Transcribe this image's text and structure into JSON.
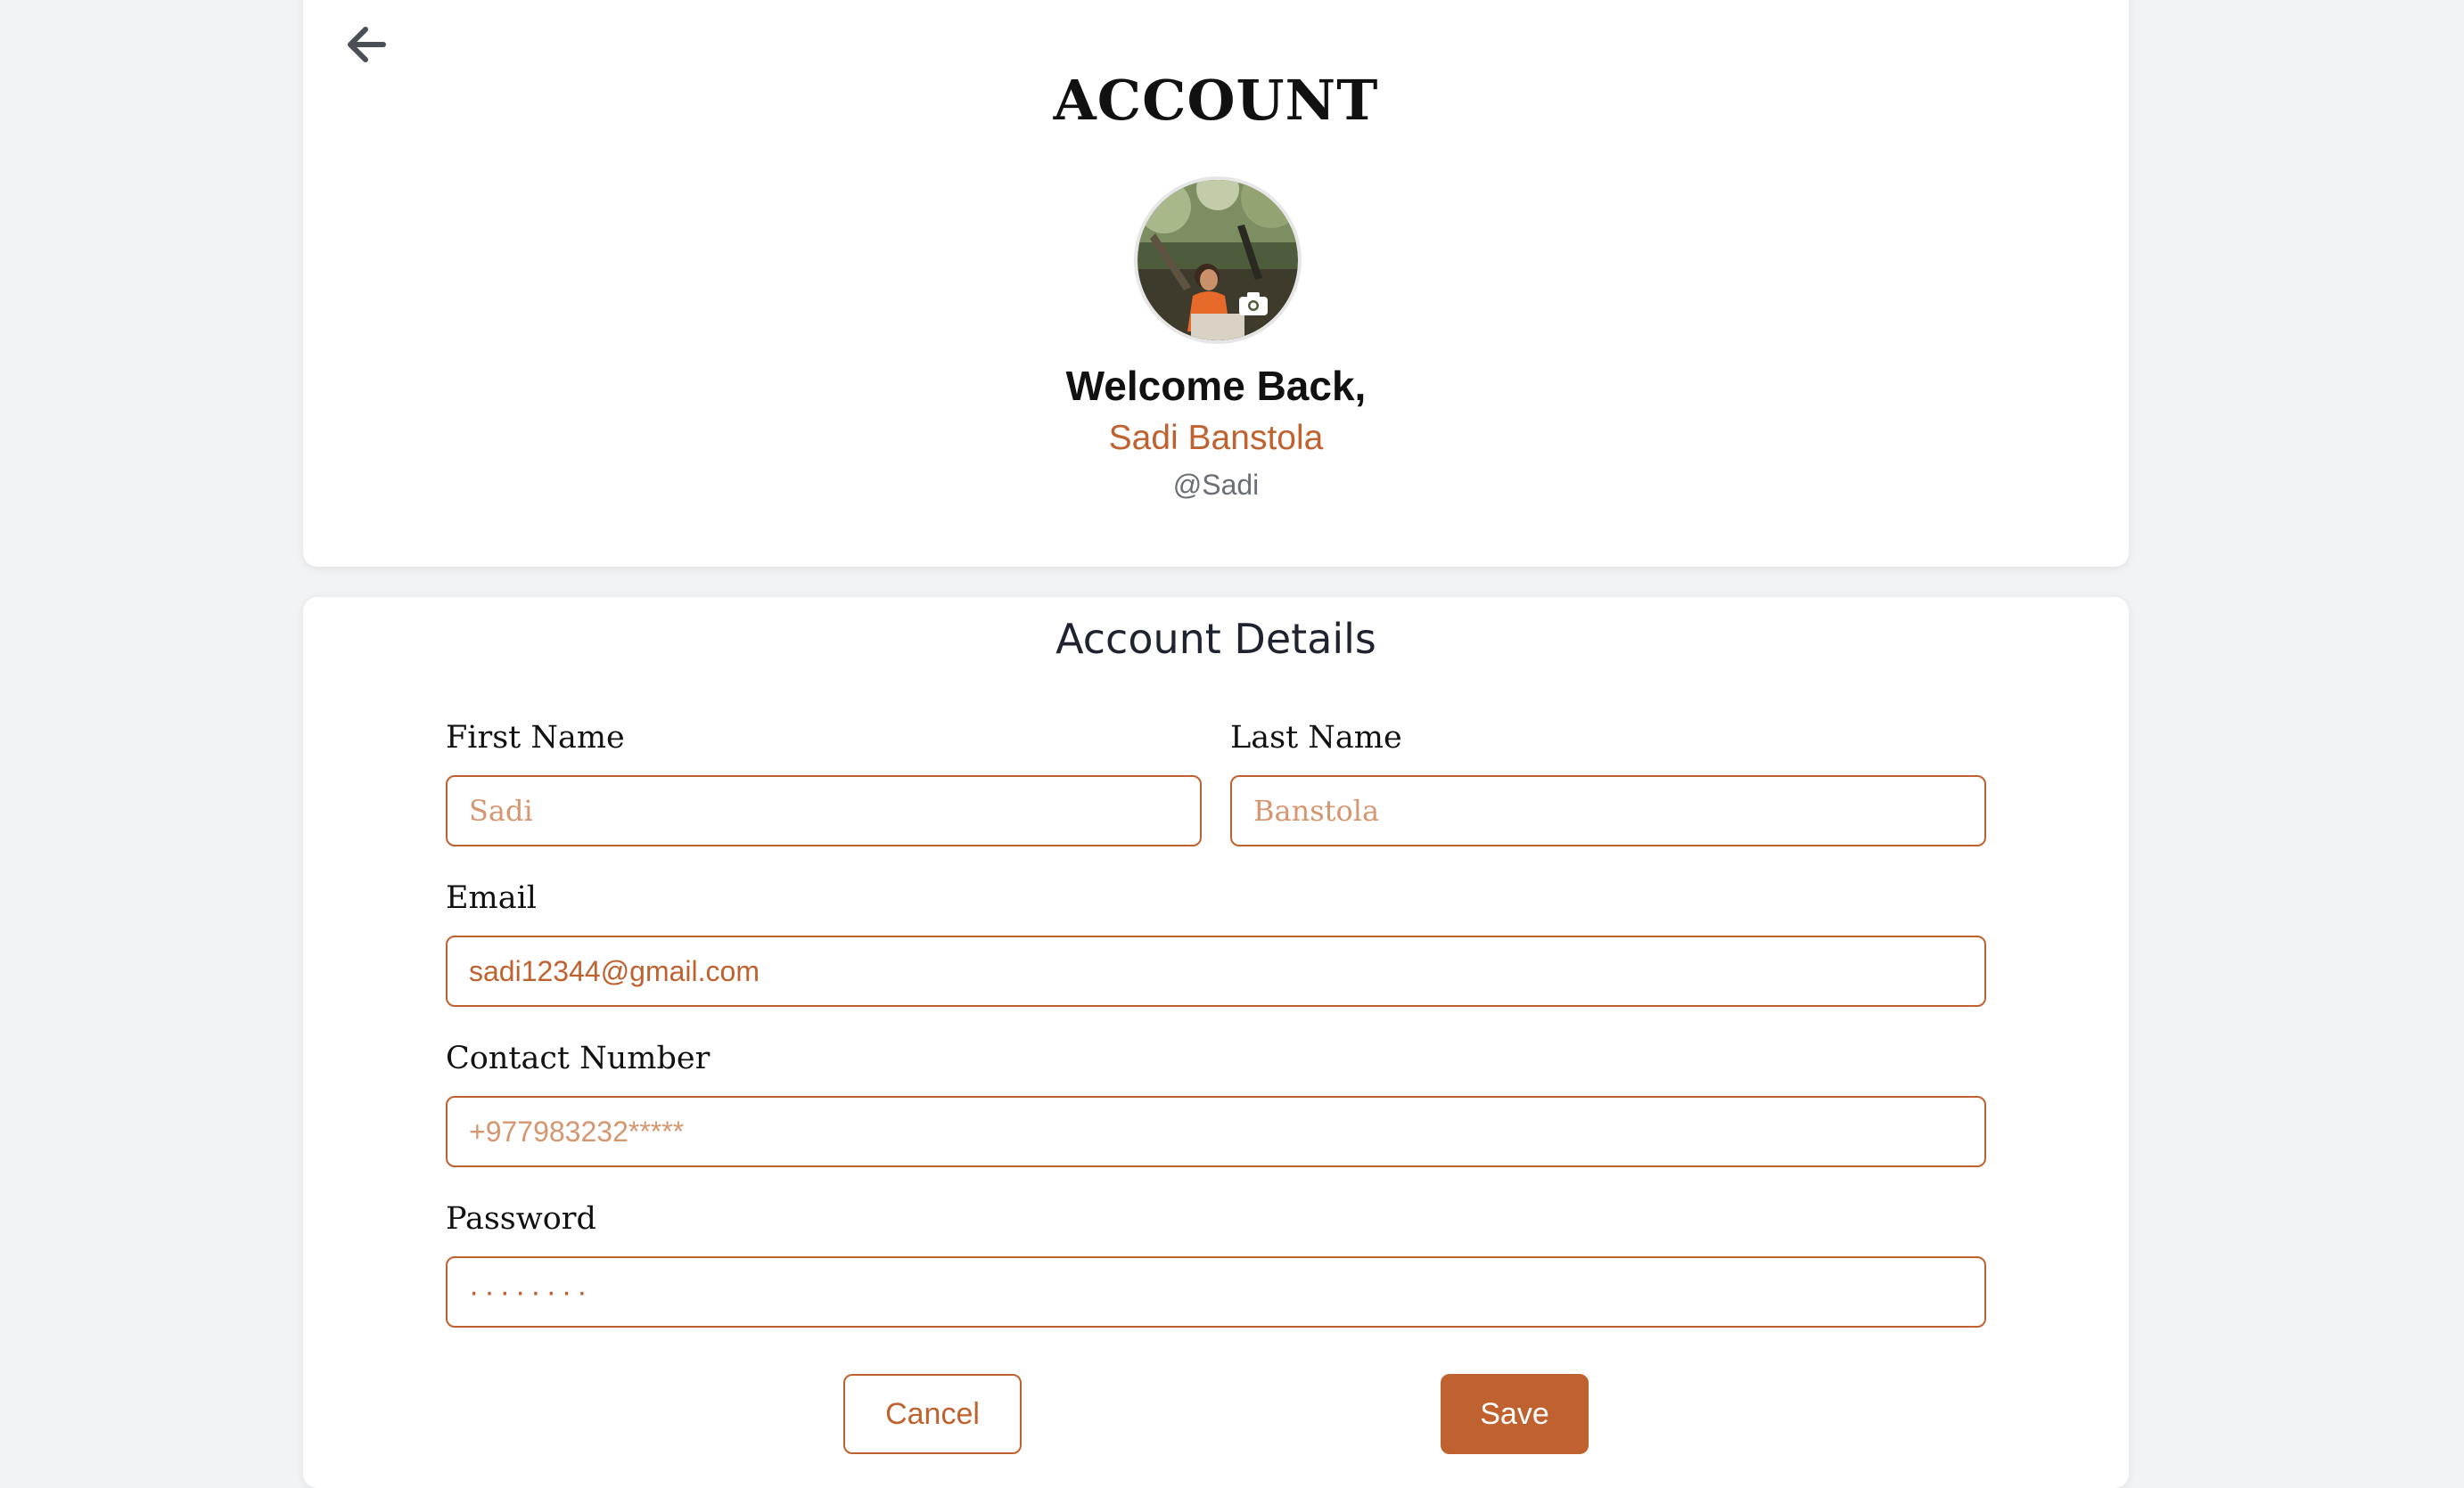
{
  "header": {
    "back_icon": "arrow-left-icon",
    "title": "ACCOUNT",
    "avatar_camera_icon": "camera-icon",
    "welcome": "Welcome Back,",
    "full_name": "Sadi Banstola",
    "username": "@Sadi"
  },
  "form": {
    "section_title": "Account Details",
    "first_name": {
      "label": "First Name",
      "placeholder": "Sadi"
    },
    "last_name": {
      "label": "Last Name",
      "placeholder": "Banstola"
    },
    "email": {
      "label": "Email",
      "value": "sadi12344@gmail.com"
    },
    "contact": {
      "label": "Contact Number",
      "placeholder": "+977983232*****"
    },
    "password": {
      "label": "Password",
      "value": "········"
    },
    "cancel_label": "Cancel",
    "save_label": "Save"
  },
  "colors": {
    "accent": "#c0622f",
    "background": "#f2f3f5",
    "card": "#ffffff"
  }
}
